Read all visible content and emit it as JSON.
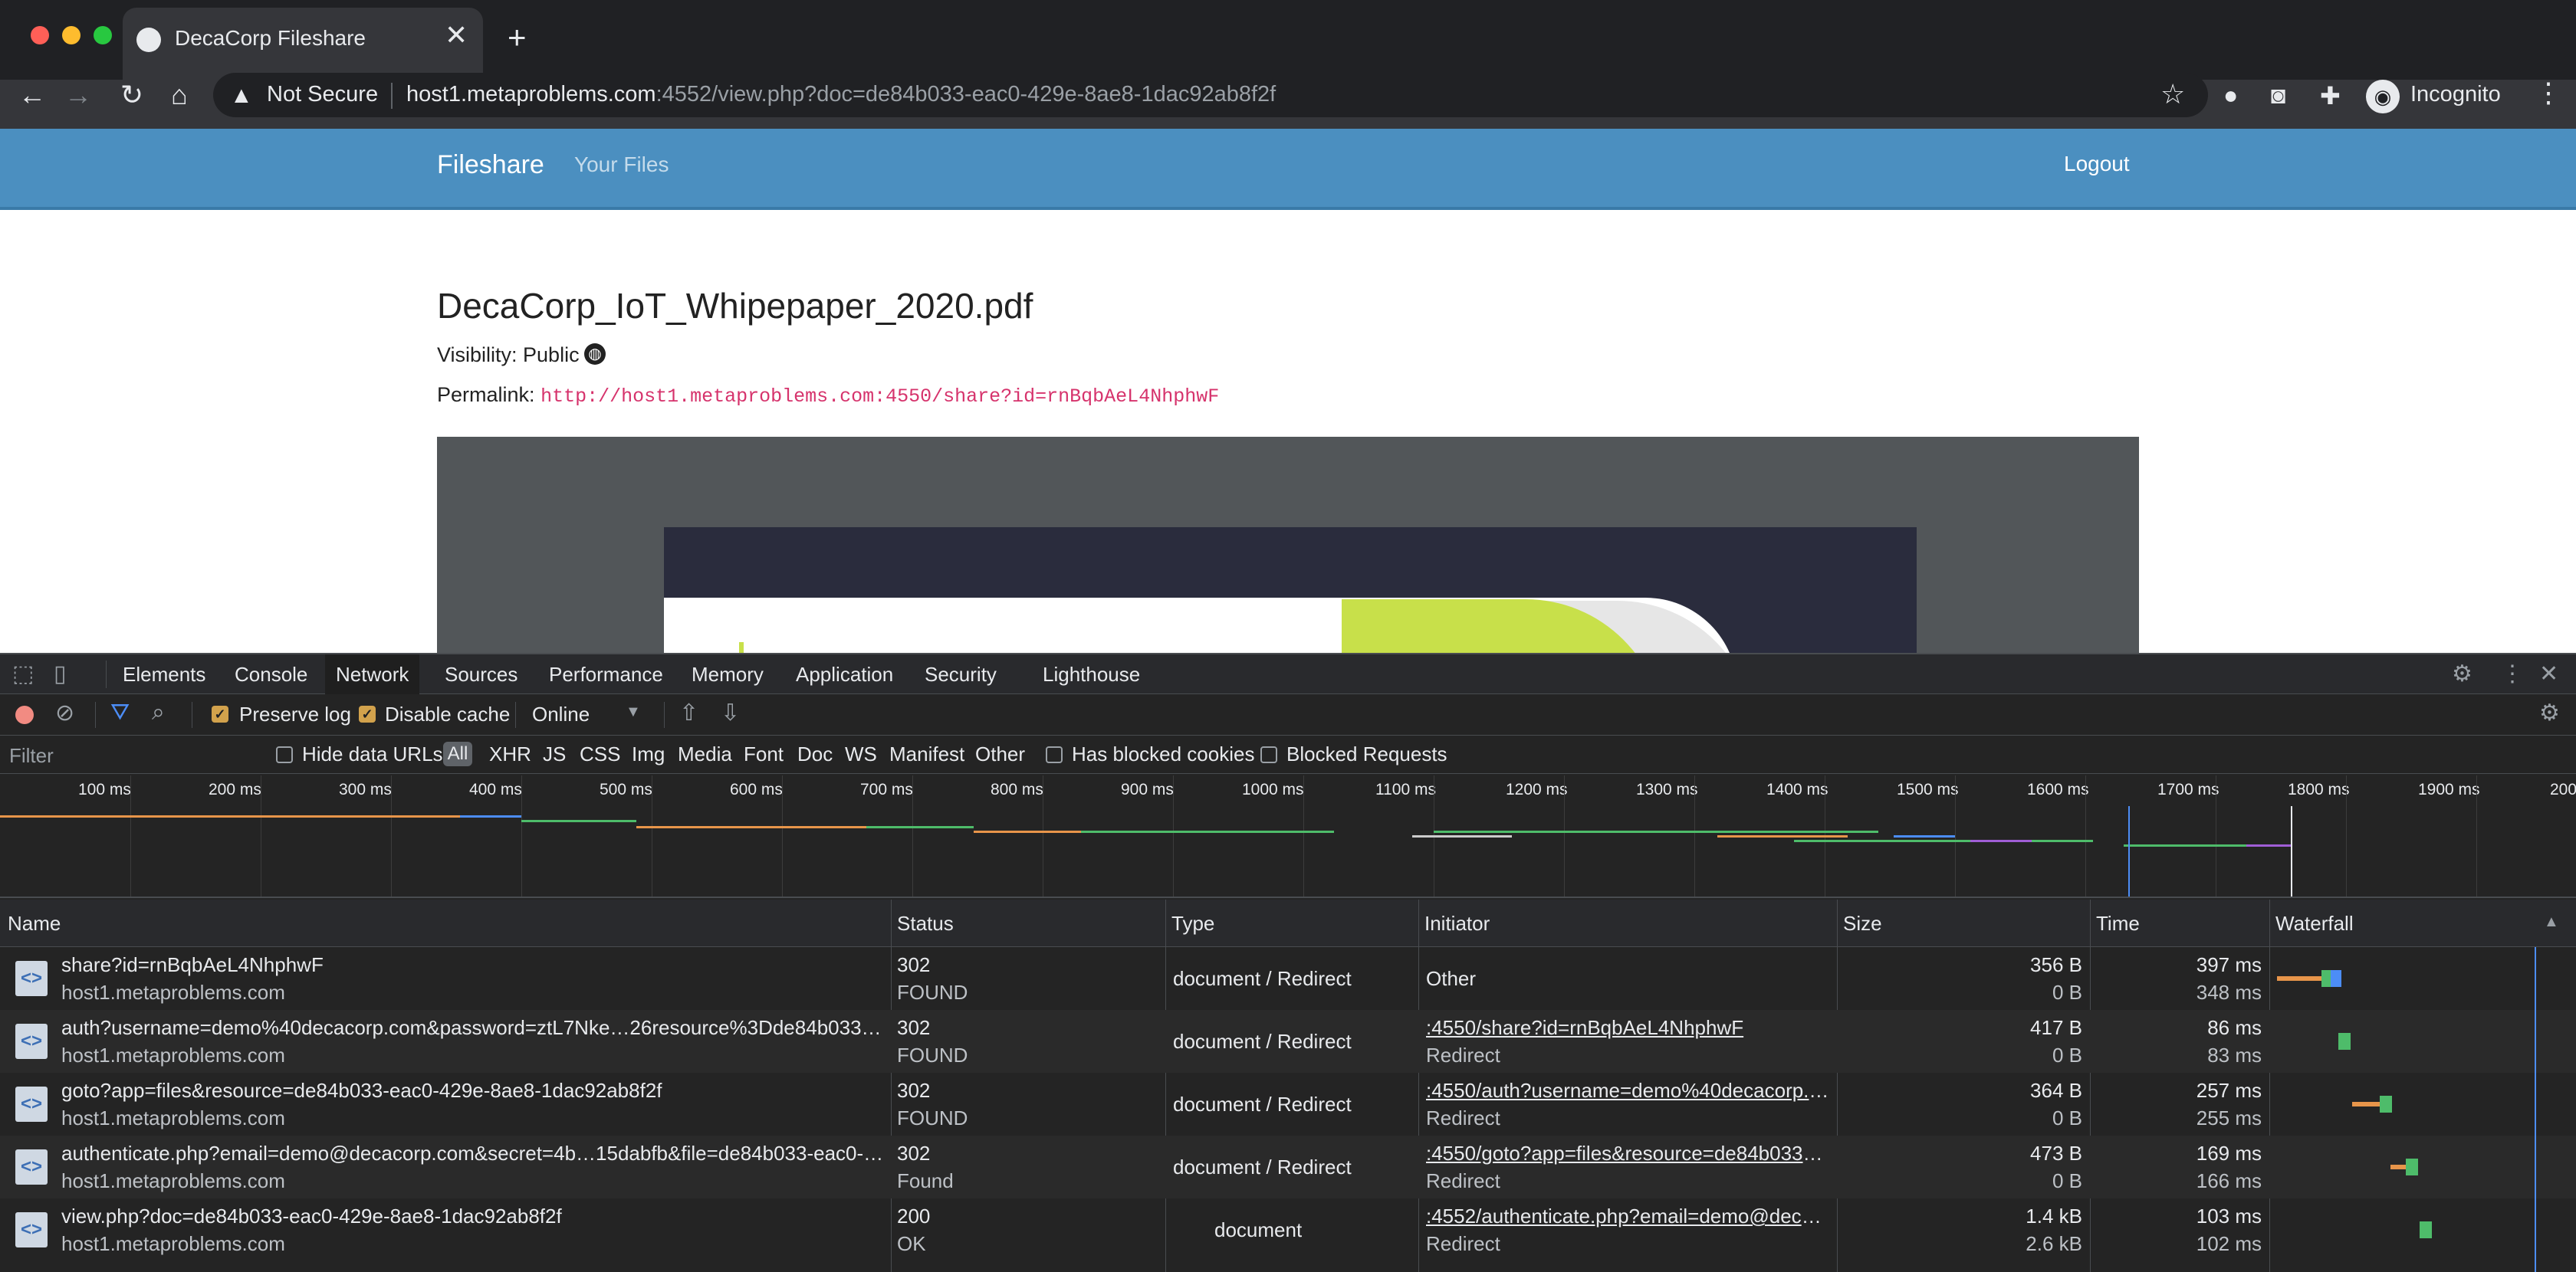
{
  "browser": {
    "tab_title": "DecaCorp Fileshare",
    "tab_close": "✕",
    "new_tab": "+",
    "security_label": "Not Secure",
    "url_host": "host1.metaproblems.com",
    "url_path": ":4552/view.php?doc=de84b033-eac0-429e-8ae8-1dac92ab8f2f",
    "profile_label": "Incognito",
    "icons": [
      "back-icon",
      "forward-icon",
      "reload-icon",
      "home-icon",
      "star-icon",
      "extension-icon",
      "camera-icon",
      "puzzle-icon",
      "incognito-icon",
      "menu-icon"
    ]
  },
  "site": {
    "brand": "Fileshare",
    "nav_your_files": "Your Files",
    "logout": "Logout",
    "doc_title": "DecaCorp_IoT_Whipepaper_2020.pdf",
    "visibility_label": "Visibility: Public",
    "permalink_label": "Permalink:",
    "permalink_url": "http://host1.metaproblems.com:4550/share?id=rnBqbAeL4NhphwF"
  },
  "devtools": {
    "tabs": [
      "Elements",
      "Console",
      "Network",
      "Sources",
      "Performance",
      "Memory",
      "Application",
      "Security",
      "Lighthouse"
    ],
    "active_tab": "Network",
    "preserve_log": "Preserve log",
    "disable_cache": "Disable cache",
    "throttling": "Online",
    "filter_placeholder": "Filter",
    "hide_data_urls": "Hide data URLs",
    "types": [
      "All",
      "XHR",
      "JS",
      "CSS",
      "Img",
      "Media",
      "Font",
      "Doc",
      "WS",
      "Manifest",
      "Other"
    ],
    "has_blocked_cookies": "Has blocked cookies",
    "blocked_requests": "Blocked Requests",
    "timeline_ticks": [
      "100 ms",
      "200 ms",
      "300 ms",
      "400 ms",
      "500 ms",
      "600 ms",
      "700 ms",
      "800 ms",
      "900 ms",
      "1000 ms",
      "1100 ms",
      "1200 ms",
      "1300 ms",
      "1400 ms",
      "1500 ms",
      "1600 ms",
      "1700 ms",
      "1800 ms",
      "1900 ms",
      "200"
    ],
    "columns": {
      "name": "Name",
      "status": "Status",
      "type": "Type",
      "initiator": "Initiator",
      "size": "Size",
      "time": "Time",
      "waterfall": "Waterfall"
    },
    "rows": [
      {
        "name": "share?id=rnBqbAeL4NhphwF",
        "domain": "host1.metaproblems.com",
        "status": "302",
        "status_text": "FOUND",
        "type": "document / Redirect",
        "initiator": "Other",
        "initiator_sub": "",
        "size": "356 B",
        "size_sub": "0 B",
        "time": "397 ms",
        "time_sub": "348 ms"
      },
      {
        "name": "auth?username=demo%40decacorp.com&password=ztL7Nke…26resource%3Dde84b033-eac0-…",
        "domain": "host1.metaproblems.com",
        "status": "302",
        "status_text": "FOUND",
        "type": "document / Redirect",
        "initiator": ":4550/share?id=rnBqbAeL4NhphwF",
        "initiator_sub": "Redirect",
        "size": "417 B",
        "size_sub": "0 B",
        "time": "86 ms",
        "time_sub": "83 ms"
      },
      {
        "name": "goto?app=files&resource=de84b033-eac0-429e-8ae8-1dac92ab8f2f",
        "domain": "host1.metaproblems.com",
        "status": "302",
        "status_text": "FOUND",
        "type": "document / Redirect",
        "initiator": ":4550/auth?username=demo%40decacorp.co…",
        "initiator_sub": "Redirect",
        "size": "364 B",
        "size_sub": "0 B",
        "time": "257 ms",
        "time_sub": "255 ms"
      },
      {
        "name": "authenticate.php?email=demo@decacorp.com&secret=4b…15dabfb&file=de84b033-eac0-429e-…",
        "domain": "host1.metaproblems.com",
        "status": "302",
        "status_text": "Found",
        "type": "document / Redirect",
        "initiator": ":4550/goto?app=files&resource=de84b033-ea…",
        "initiator_sub": "Redirect",
        "size": "473 B",
        "size_sub": "0 B",
        "time": "169 ms",
        "time_sub": "166 ms"
      },
      {
        "name": "view.php?doc=de84b033-eac0-429e-8ae8-1dac92ab8f2f",
        "domain": "host1.metaproblems.com",
        "status": "200",
        "status_text": "OK",
        "type": "document",
        "initiator": ":4552/authenticate.php?email=demo@decacor…",
        "initiator_sub": "Redirect",
        "size": "1.4 kB",
        "size_sub": "2.6 kB",
        "time": "103 ms",
        "time_sub": "102 ms"
      }
    ]
  }
}
